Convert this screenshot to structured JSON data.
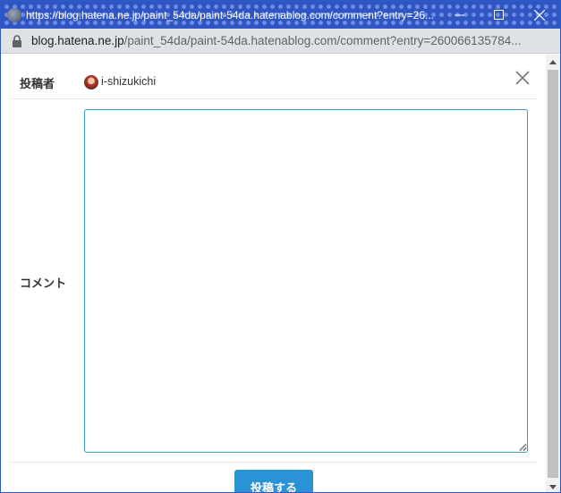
{
  "window": {
    "title": "https://blog.hatena.ne.jp/paint_54da/paint-54da.hatenablog.com/comment?entry=26...",
    "minimize_icon": "minimize-icon",
    "maximize_icon": "maximize-icon",
    "close_icon": "close-icon"
  },
  "address_bar": {
    "host": "blog.hatena.ne.jp",
    "path": "/paint_54da/paint-54da.hatenablog.com/comment?entry=260066135784..."
  },
  "form": {
    "author_label": "投稿者",
    "author_name": "i-shizukichi",
    "comment_label": "コメント",
    "comment_value": "",
    "submit_label": "投稿する"
  },
  "colors": {
    "titlebar": "#3056c4",
    "accent": "#2a93d5",
    "textarea_border": "#3a9bc7"
  }
}
